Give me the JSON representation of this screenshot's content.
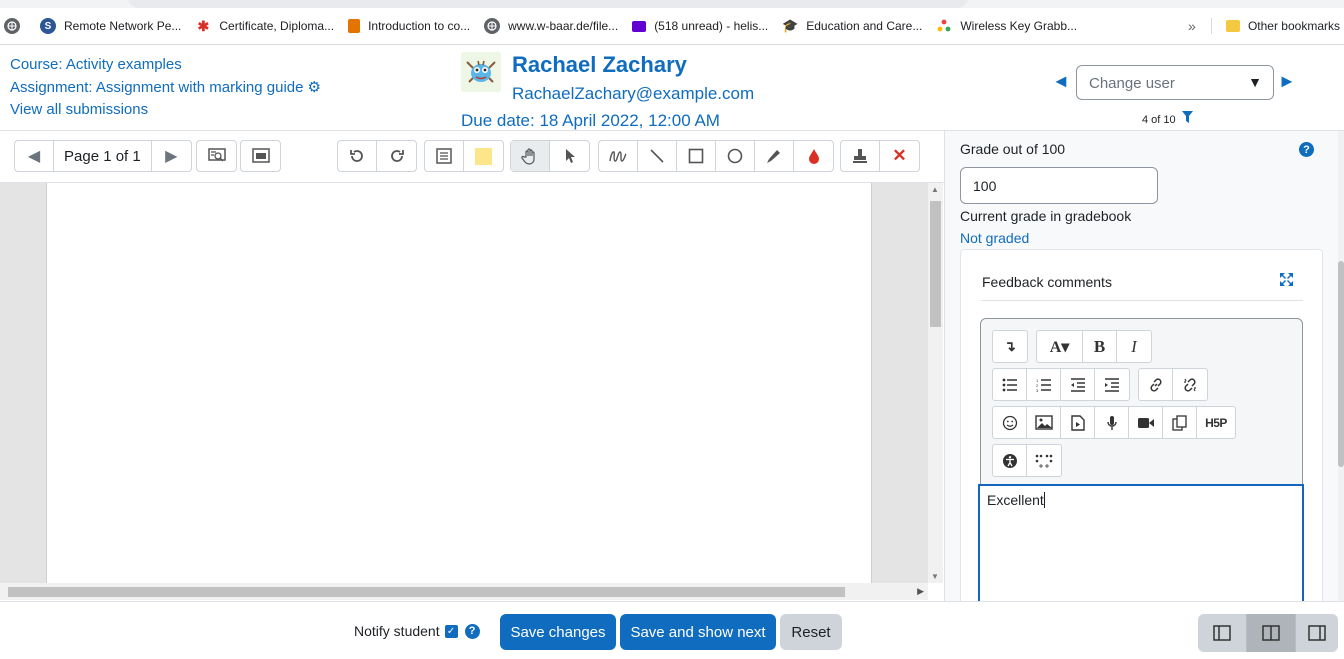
{
  "browser": {
    "bookmarks": [
      {
        "label": "Remote Network Pe...",
        "icon": "s-logo-icon",
        "color": "#2b5797"
      },
      {
        "label": "Certificate, Diploma...",
        "icon": "red-bug-icon",
        "color": "#d93025"
      },
      {
        "label": "Introduction to co...",
        "icon": "doc-fav-icon",
        "color": "#e37400"
      },
      {
        "label": "www.w-baar.de/file...",
        "icon": "globe-icon",
        "color": "#5f6368"
      },
      {
        "label": "(518 unread) - helis...",
        "icon": "mail-icon",
        "color": "#6001d2"
      },
      {
        "label": "Education and Care...",
        "icon": "grad-cap-icon",
        "color": "#202124"
      },
      {
        "label": "Wireless Key Grabb...",
        "icon": "people-icon",
        "color": "#e8453c"
      }
    ],
    "more_chevron": "»",
    "other_bookmarks": "Other bookmarks"
  },
  "header": {
    "course_link": "Course: Activity examples",
    "assignment_link": "Assignment: Assignment with marking guide",
    "view_all_link": "View all submissions",
    "user_name": "Rachael Zachary",
    "user_email": "RachaelZachary@example.com",
    "due_date": "Due date: 18 April 2022, 12:00 AM",
    "change_user_placeholder": "Change user",
    "counter": "4 of 10"
  },
  "toolbar": {
    "page_label": "Page 1 of 1",
    "icons": [
      "prev-page-icon",
      "next-page-icon",
      "search-comments-icon",
      "expand-view-icon",
      "rotate-left-icon",
      "rotate-right-icon",
      "comment-icon",
      "comment-color-icon",
      "pan-hand-icon",
      "select-arrow-icon",
      "pen-icon",
      "line-icon",
      "rectangle-icon",
      "oval-icon",
      "highlighter-icon",
      "annotation-color-icon",
      "stamp-icon",
      "delete-icon"
    ],
    "active_tool": "pan-hand-icon",
    "comment_color": "#fde68a",
    "annotation_color": "#d93025"
  },
  "grading": {
    "grade_label": "Grade out of 100",
    "grade_value": "100",
    "current_grade_label": "Current grade in gradebook",
    "current_grade_value": "Not graded",
    "feedback_title": "Feedback comments",
    "feedback_text": "Excellent"
  },
  "footer": {
    "notify_label": "Notify student",
    "notify_checked": true,
    "save_changes": "Save changes",
    "save_show_next": "Save and show next",
    "reset": "Reset"
  },
  "colors": {
    "primary": "#0f6cbf",
    "secondary": "#ced4da"
  }
}
